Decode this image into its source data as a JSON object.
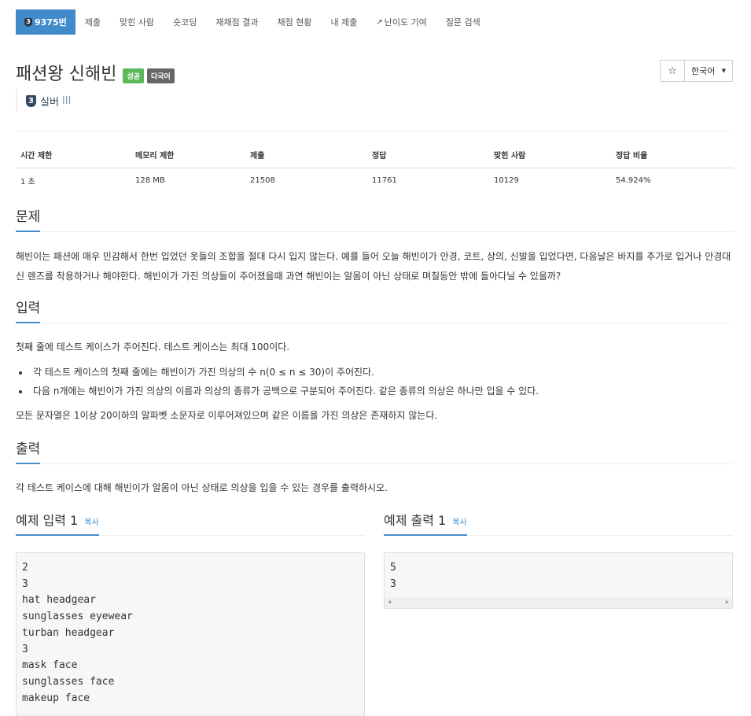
{
  "nav": {
    "items": [
      {
        "label": "9375번",
        "badge": "3"
      },
      {
        "label": "제출"
      },
      {
        "label": "맞힌 사람"
      },
      {
        "label": "숏코딩"
      },
      {
        "label": "재채점 결과"
      },
      {
        "label": "채점 현황"
      },
      {
        "label": "내 제출"
      },
      {
        "label": "난이도 기여"
      },
      {
        "label": "질문 검색"
      }
    ]
  },
  "problem": {
    "title": "패션왕 신해빈",
    "labels": [
      "성공",
      "다국어"
    ],
    "tier_number": "3",
    "tier_name": "실버",
    "tier_level": "III"
  },
  "buttons": {
    "star": "☆",
    "language": "한국어"
  },
  "stats": {
    "headers": [
      "시간 제한",
      "메모리 제한",
      "제출",
      "정답",
      "맞힌 사람",
      "정답 비율"
    ],
    "values": [
      "1 초",
      "128 MB",
      "21508",
      "11761",
      "10129",
      "54.924%"
    ]
  },
  "sections": {
    "problem_title": "문제",
    "problem_text": "해빈이는 패션에 매우 민감해서 한번 입었던 옷들의 조합을 절대 다시 입지 않는다. 예를 들어 오늘 해빈이가 안경, 코트, 상의, 신발을 입었다면, 다음날은 바지를 추가로 입거나 안경대신 렌즈를 착용하거나 해야한다. 해빈이가 가진 의상들이 주어졌을때 과연 해빈이는 알몸이 아닌 상태로 며칠동안 밖에 돌아다닐 수 있을까?",
    "input_title": "입력",
    "input_intro": "첫째 줄에 테스트 케이스가 주어진다. 테스트 케이스는 최대 100이다.",
    "input_items": [
      "각 테스트 케이스의 첫째 줄에는 해빈이가 가진 의상의 수 n(0 ≤ n ≤ 30)이 주어진다.",
      "다음 n개에는 해빈이가 가진 의상의 이름과 의상의 종류가 공백으로 구분되어 주어진다. 같은 종류의 의상은 하나만 입을 수 있다."
    ],
    "input_outro": "모든 문자열은 1이상 20이하의 알파벳 소문자로 이루어져있으며 같은 이름을 가진 의상은 존재하지 않는다.",
    "output_title": "출력",
    "output_text": "각 테스트 케이스에 대해 해빈이가 알몸이 아닌 상태로 의상을 입을 수 있는 경우를 출력하시오."
  },
  "samples": {
    "input_title": "예제 입력 1",
    "output_title": "예제 출력 1",
    "copy_label": "복사",
    "input": "2\n3\nhat headgear\nsunglasses eyewear\nturban headgear\n3\nmask face\nsunglasses face\nmakeup face",
    "output": "5\n3"
  }
}
